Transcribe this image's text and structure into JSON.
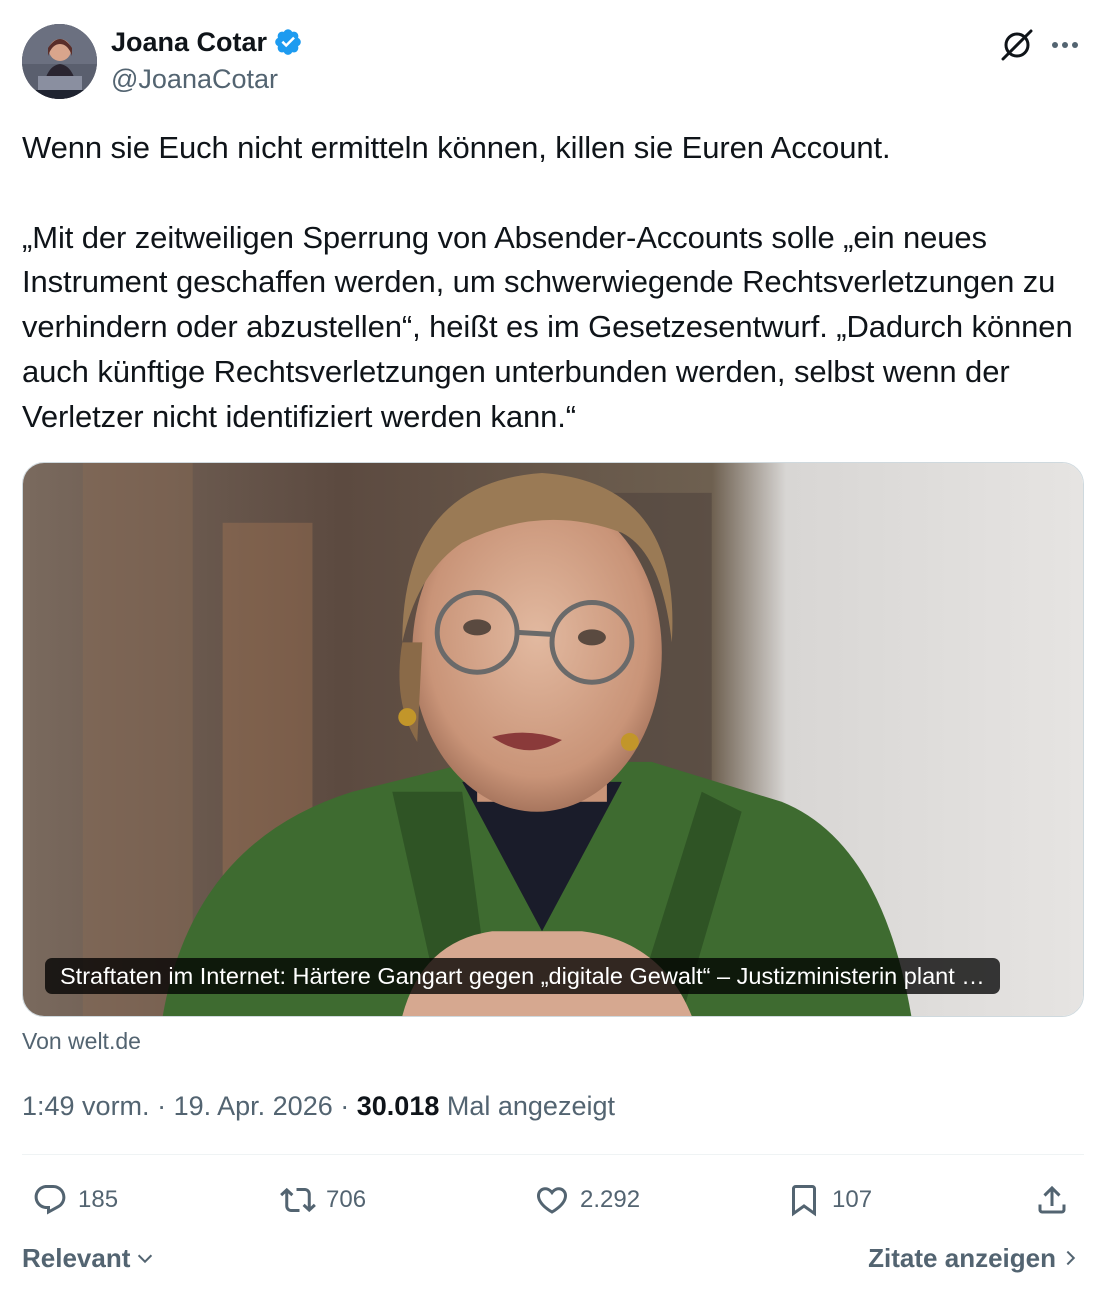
{
  "author": {
    "name": "Joana Cotar",
    "handle": "@JoanaCotar",
    "verified": true,
    "verified_color": "#1d9bf0"
  },
  "tweet": {
    "text": "Wenn sie Euch nicht ermitteln können, killen sie Euren Account.\n\n„Mit der zeitweiligen Sperrung von Absender-Accounts solle „ein neues Instrument geschaffen werden, um schwerwiegende Rechtsverletzungen zu verhindern oder abzustellen“, heißt es im Gesetzesentwurf. „Dadurch können auch künftige Rechtsverletzungen unterbunden werden, selbst wenn der Verletzer nicht identifiziert werden kann.“"
  },
  "link_card": {
    "title": "Straftaten im Internet: Härtere Gangart gegen „digitale Gewalt“ – Justizministerin plant …",
    "source": "Von welt.de"
  },
  "meta": {
    "time": "1:49 vorm.",
    "separator": "·",
    "date": "19. Apr. 2026",
    "views_count": "30.018",
    "views_label": "Mal angezeigt"
  },
  "actions": {
    "replies": "185",
    "reposts": "706",
    "likes": "2.292",
    "bookmarks": "107"
  },
  "footer": {
    "sort_label": "Relevant",
    "quotes_label": "Zitate anzeigen"
  },
  "icons": {
    "grok": "grok-icon",
    "more": "more-icon",
    "reply": "reply-icon",
    "repost": "repost-icon",
    "like": "heart-icon",
    "bookmark": "bookmark-icon",
    "share": "share-icon"
  }
}
